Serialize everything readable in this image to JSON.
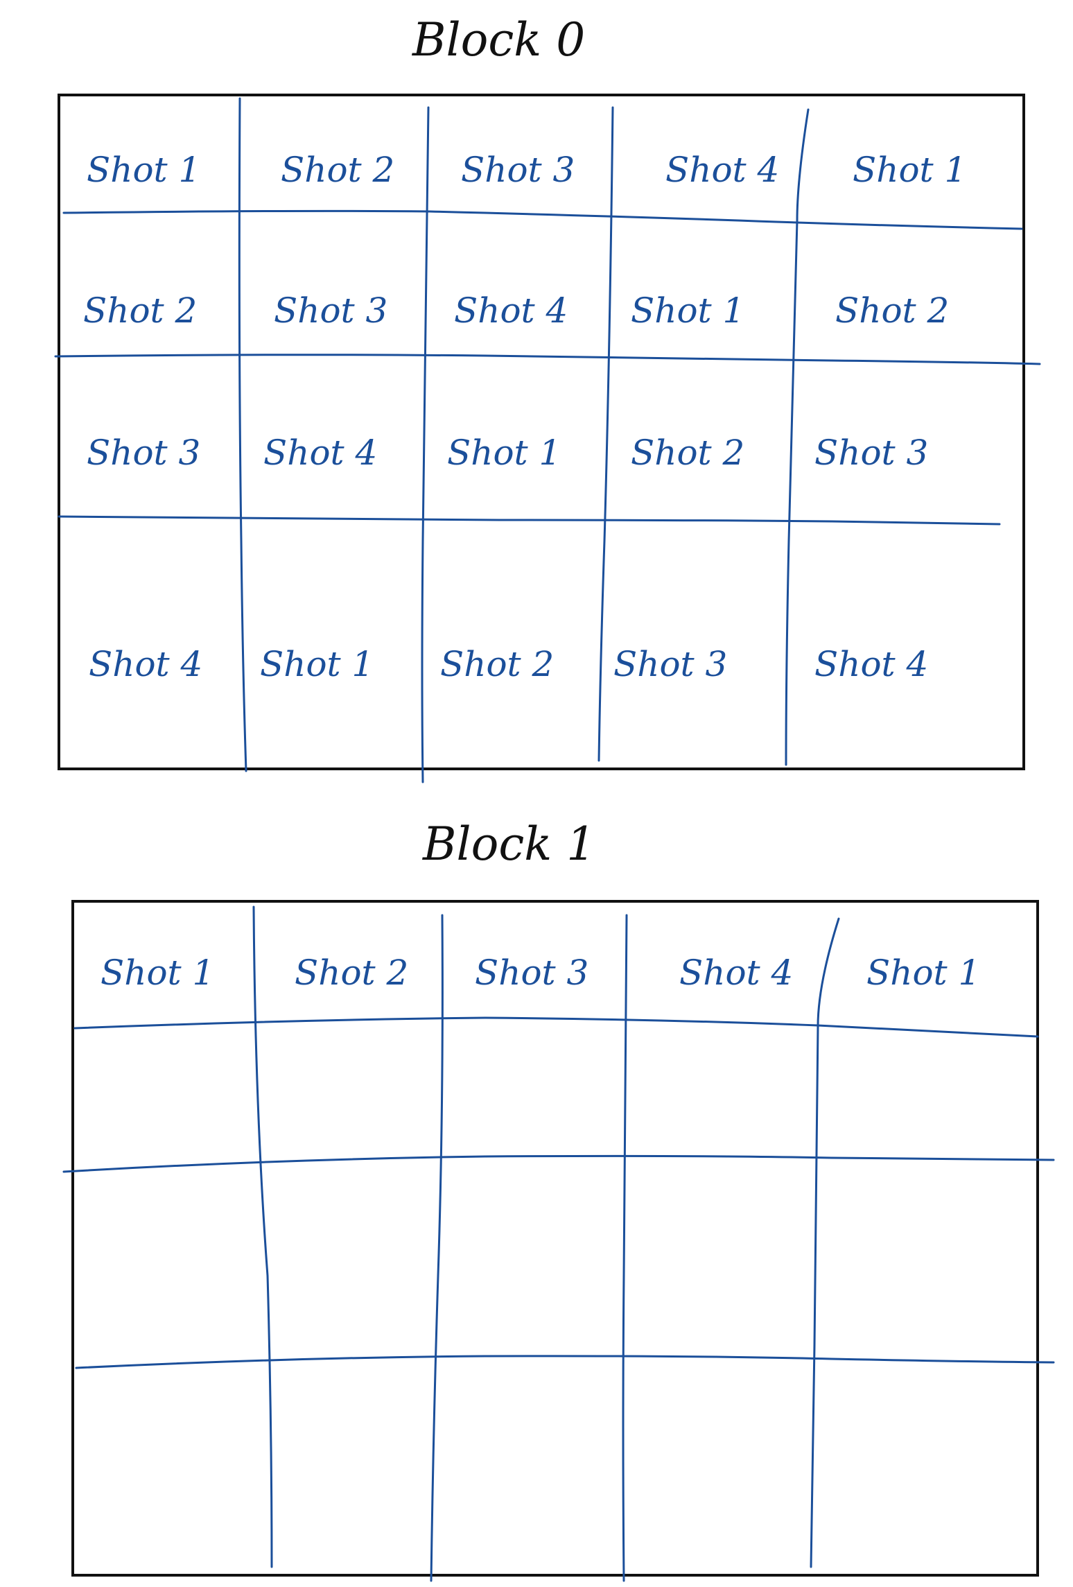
{
  "colors": {
    "ink": "#1b4f9a",
    "frame": "#111111"
  },
  "blocks": [
    {
      "title": "Block 0",
      "rows": [
        [
          "Shot 1",
          "Shot 2",
          "Shot 3",
          "Shot 4",
          "Shot 1"
        ],
        [
          "Shot 2",
          "Shot 3",
          "Shot 4",
          "Shot 1",
          "Shot 2"
        ],
        [
          "Shot 3",
          "Shot 4",
          "Shot 1",
          "Shot 2",
          "Shot 3"
        ],
        [
          "Shot 4",
          "Shot 1",
          "Shot 2",
          "Shot 3",
          "Shot 4"
        ]
      ]
    },
    {
      "title": "Block 1",
      "rows": [
        [
          "Shot 1",
          "Shot 2",
          "Shot 3",
          "Shot 4",
          "Shot 1"
        ],
        [
          "",
          "",
          "",
          "",
          ""
        ],
        [
          "",
          "",
          "",
          "",
          ""
        ],
        [
          "",
          "",
          "",
          "",
          ""
        ]
      ]
    }
  ]
}
